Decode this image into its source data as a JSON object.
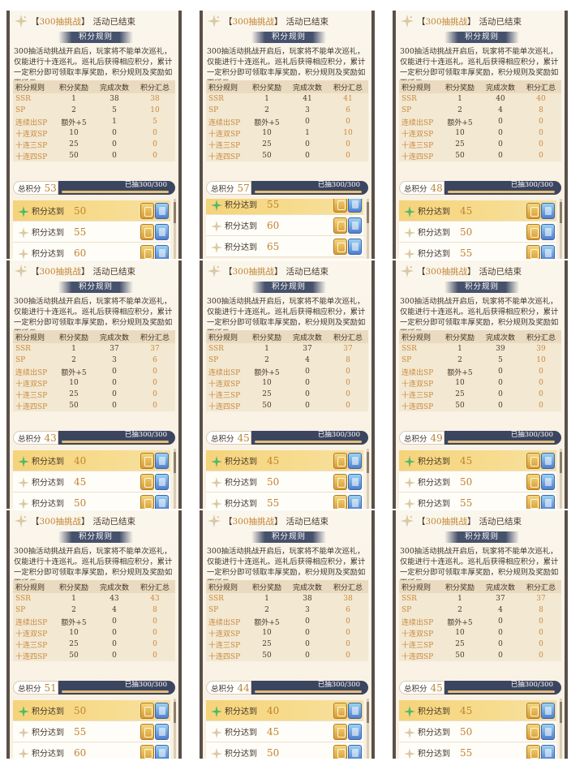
{
  "header": {
    "bracket_open": "【",
    "event_highlight": "300抽挑战",
    "bracket_close": "】",
    "status": "活动已结束"
  },
  "rule_title": "积分规则",
  "description": "300抽活动挑战开启后，玩家将不能单次巡礼，仅能进行十连巡礼。巡礼后获得相应积分，累计一定积分即可领取丰厚奖励，积分规则及奖励如下所示：",
  "table_headers": [
    "积分规则",
    "积分奖励",
    "完成次数",
    "积分汇总"
  ],
  "row_names": [
    "SSR",
    "SP",
    "连续出SP",
    "十连双SP",
    "十连三SP",
    "十连四SP"
  ],
  "row_rewards": [
    "1",
    "2",
    "额外+5",
    "10",
    "25",
    "50"
  ],
  "total_label": "总积分",
  "pull_status": "已抽300/300",
  "reward_label": "积分达到",
  "colors": {
    "accent_gold": "#c0832f",
    "navy_bar": "#3c4560",
    "highlight_row": "#f5d37a"
  },
  "panels": [
    {
      "counts": [
        "38",
        "5",
        "1",
        "0",
        "0",
        "0"
      ],
      "sums": [
        "38",
        "10",
        "5",
        "0",
        "0",
        "0"
      ],
      "total": "53",
      "reward_points": [
        "50",
        "55",
        "60"
      ],
      "highlight_first": true,
      "scroll_offset": 0
    },
    {
      "counts": [
        "41",
        "3",
        "0",
        "1",
        "0",
        "0"
      ],
      "sums": [
        "41",
        "6",
        "0",
        "10",
        "0",
        "0"
      ],
      "total": "57",
      "reward_points": [
        "55",
        "60",
        "65"
      ],
      "highlight_first": true,
      "scroll_offset": 1
    },
    {
      "counts": [
        "40",
        "4",
        "0",
        "0",
        "0",
        "0"
      ],
      "sums": [
        "40",
        "8",
        "0",
        "0",
        "0",
        "0"
      ],
      "total": "48",
      "reward_points": [
        "45",
        "50",
        "55"
      ],
      "highlight_first": true,
      "scroll_offset": 0
    },
    {
      "counts": [
        "37",
        "3",
        "0",
        "0",
        "0",
        "0"
      ],
      "sums": [
        "37",
        "6",
        "0",
        "0",
        "0",
        "0"
      ],
      "total": "43",
      "reward_points": [
        "40",
        "45",
        "50"
      ],
      "highlight_first": true,
      "scroll_offset": 0
    },
    {
      "counts": [
        "37",
        "4",
        "0",
        "0",
        "0",
        "0"
      ],
      "sums": [
        "37",
        "8",
        "0",
        "0",
        "0",
        "0"
      ],
      "total": "45",
      "reward_points": [
        "45",
        "50",
        "55"
      ],
      "highlight_first": true,
      "scroll_offset": 0
    },
    {
      "counts": [
        "39",
        "5",
        "0",
        "0",
        "0",
        "0"
      ],
      "sums": [
        "39",
        "10",
        "0",
        "0",
        "0",
        "0"
      ],
      "total": "49",
      "reward_points": [
        "45",
        "50",
        "55"
      ],
      "highlight_first": true,
      "scroll_offset": 0
    },
    {
      "counts": [
        "43",
        "4",
        "0",
        "0",
        "0",
        "0"
      ],
      "sums": [
        "43",
        "8",
        "0",
        "0",
        "0",
        "0"
      ],
      "total": "51",
      "reward_points": [
        "50",
        "55",
        "60"
      ],
      "highlight_first": true,
      "scroll_offset": 0
    },
    {
      "counts": [
        "38",
        "3",
        "0",
        "0",
        "0",
        "0"
      ],
      "sums": [
        "38",
        "6",
        "0",
        "0",
        "0",
        "0"
      ],
      "total": "44",
      "reward_points": [
        "40",
        "45",
        "50"
      ],
      "highlight_first": true,
      "scroll_offset": 0
    },
    {
      "counts": [
        "37",
        "4",
        "0",
        "0",
        "0",
        "0"
      ],
      "sums": [
        "37",
        "8",
        "0",
        "0",
        "0",
        "0"
      ],
      "total": "45",
      "reward_points": [
        "45",
        "50",
        "55"
      ],
      "highlight_first": true,
      "scroll_offset": 0
    }
  ]
}
